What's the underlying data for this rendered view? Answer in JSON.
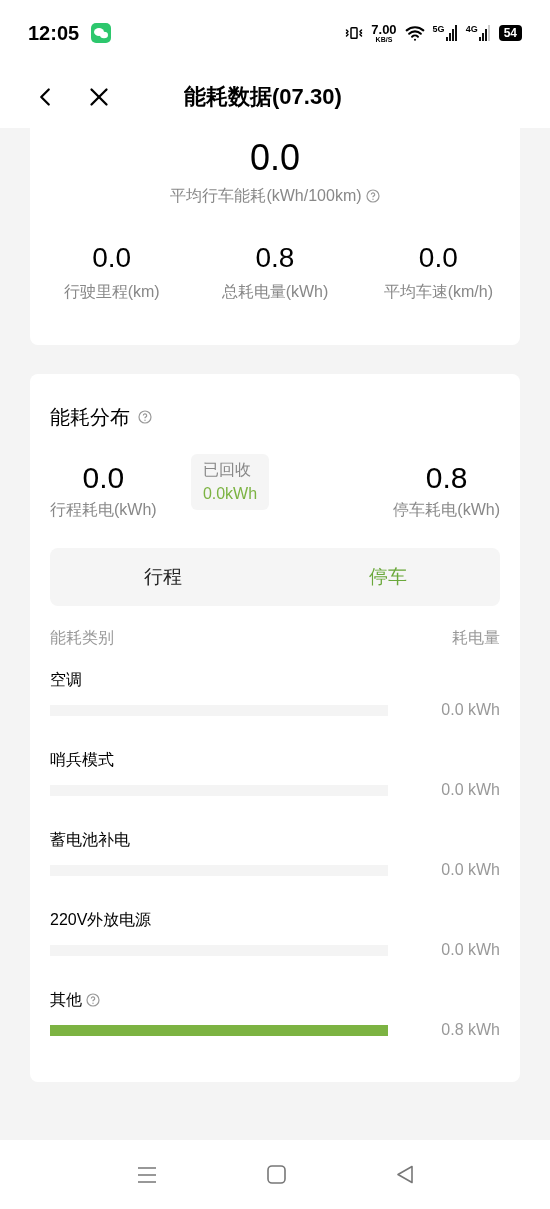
{
  "status_bar": {
    "time": "12:05",
    "speed": "7.00",
    "speed_unit": "KB/S",
    "net1": "5G",
    "net2": "4G",
    "battery": "54"
  },
  "header": {
    "title": "能耗数据(07.30)"
  },
  "summary": {
    "main_value": "0.0",
    "main_label": "平均行车能耗(kWh/100km)",
    "stats": [
      {
        "value": "0.0",
        "label": "行驶里程(km)"
      },
      {
        "value": "0.8",
        "label": "总耗电量(kWh)"
      },
      {
        "value": "0.0",
        "label": "平均车速(km/h)"
      }
    ]
  },
  "distribution": {
    "title": "能耗分布",
    "left": {
      "value": "0.0",
      "label": "行程耗电(kWh)"
    },
    "recovered": {
      "label": "已回收",
      "value": "0.0kWh"
    },
    "right": {
      "value": "0.8",
      "label": "停车耗电(kWh)"
    },
    "tabs": [
      {
        "label": "行程",
        "selected": false
      },
      {
        "label": "停车",
        "selected": true
      }
    ],
    "columns": [
      "能耗类别",
      "耗电量"
    ],
    "rows": [
      {
        "name": "空调",
        "help": false,
        "level": 0,
        "reading": "0.0 kWh"
      },
      {
        "name": "哨兵模式",
        "help": false,
        "level": 0,
        "reading": "0.0 kWh"
      },
      {
        "name": "蓄电池补电",
        "help": false,
        "level": 0,
        "reading": "0.0 kWh"
      },
      {
        "name": "220V外放电源",
        "help": false,
        "level": 0,
        "reading": "0.0 kWh"
      },
      {
        "name": "其他",
        "help": true,
        "level": 1,
        "reading": "0.8 kWh"
      }
    ]
  }
}
